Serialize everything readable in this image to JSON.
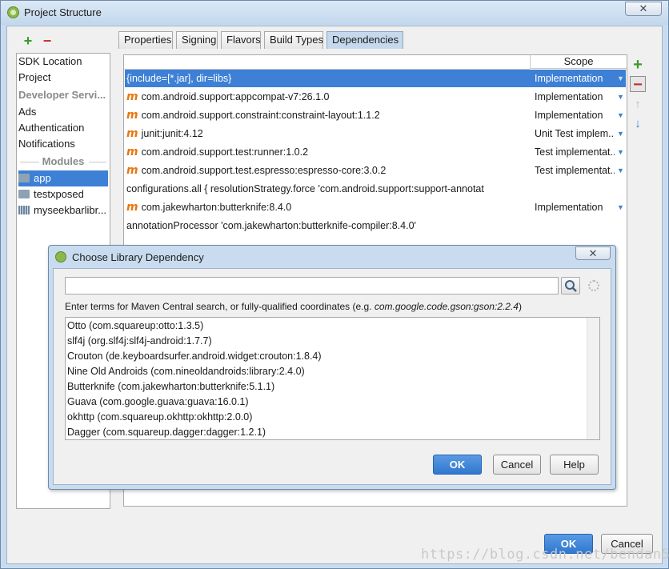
{
  "window": {
    "title": "Project Structure",
    "close_label": "✕"
  },
  "left_toolbar": {
    "add_label": "+",
    "remove_label": "−"
  },
  "left_panel": {
    "items": [
      {
        "label": "SDK Location",
        "kind": "item"
      },
      {
        "label": "Project",
        "kind": "item"
      },
      {
        "label": "Developer Servi...",
        "kind": "header"
      },
      {
        "label": "Ads",
        "kind": "item"
      },
      {
        "label": "Authentication",
        "kind": "item"
      },
      {
        "label": "Notifications",
        "kind": "item"
      },
      {
        "label": "Modules",
        "kind": "section"
      },
      {
        "label": "app",
        "kind": "module",
        "selected": true
      },
      {
        "label": "testxposed",
        "kind": "module"
      },
      {
        "label": "myseekbarlibr...",
        "kind": "library"
      }
    ]
  },
  "tabs": [
    {
      "label": "Properties"
    },
    {
      "label": "Signing"
    },
    {
      "label": "Flavors"
    },
    {
      "label": "Build Types"
    },
    {
      "label": "Dependencies",
      "active": true
    }
  ],
  "dependencies": {
    "scope_header": "Scope",
    "rows": [
      {
        "coord": "{include=[*.jar], dir=libs}",
        "scope": "Implementation",
        "maven": false,
        "selected": true,
        "dropdown": true
      },
      {
        "coord": "com.android.support:appcompat-v7:26.1.0",
        "scope": "Implementation",
        "maven": true,
        "dropdown": true
      },
      {
        "coord": "com.android.support.constraint:constraint-layout:1.1.2",
        "scope": "Implementation",
        "maven": true,
        "dropdown": true
      },
      {
        "coord": "junit:junit:4.12",
        "scope": "Unit Test implem...",
        "maven": true,
        "dropdown": true
      },
      {
        "coord": "com.android.support.test:runner:1.0.2",
        "scope": "Test implementat...",
        "maven": true,
        "dropdown": true
      },
      {
        "coord": "com.android.support.test.espresso:espresso-core:3.0.2",
        "scope": "Test implementat...",
        "maven": true,
        "dropdown": true
      },
      {
        "coord": "configurations.all {         resolutionStrategy.force 'com.android.support:support-annotat",
        "scope": "",
        "maven": false,
        "wide": true
      },
      {
        "coord": "com.jakewharton:butterknife:8.4.0",
        "scope": "Implementation",
        "maven": true,
        "dropdown": true
      },
      {
        "coord": "annotationProcessor 'com.jakewharton:butterknife-compiler:8.4.0'",
        "scope": "",
        "maven": false,
        "wide": true
      }
    ]
  },
  "right_toolbar": {
    "add": "+",
    "remove": "−",
    "up": "↑",
    "down": "↓"
  },
  "dialog": {
    "title": "Choose Library Dependency",
    "close_label": "✕",
    "search_value": "",
    "hint_prefix": "Enter terms for Maven Central search, or fully-qualified coordinates (e.g. ",
    "hint_example": "com.google.code.gson:gson:2.2.4",
    "hint_suffix": ")",
    "results": [
      "Otto (com.squareup:otto:1.3.5)",
      "slf4j (org.slf4j:slf4j-android:1.7.7)",
      "Crouton (de.keyboardsurfer.android.widget:crouton:1.8.4)",
      "Nine Old Androids (com.nineoldandroids:library:2.4.0)",
      "Butterknife (com.jakewharton:butterknife:5.1.1)",
      "Guava (com.google.guava:guava:16.0.1)",
      "okhttp (com.squareup.okhttp:okhttp:2.0.0)",
      "Dagger (com.squareup.dagger:dagger:1.2.1)"
    ],
    "ok_label": "OK",
    "cancel_label": "Cancel",
    "help_label": "Help"
  },
  "footer": {
    "ok_label": "OK",
    "cancel_label": "Cancel"
  },
  "watermark": "https://blog.csdn.net/bendan50",
  "colors": {
    "selection": "#3d80d5",
    "maven_icon": "#e8770e",
    "add": "#3a9b2c",
    "remove": "#c9302c"
  }
}
